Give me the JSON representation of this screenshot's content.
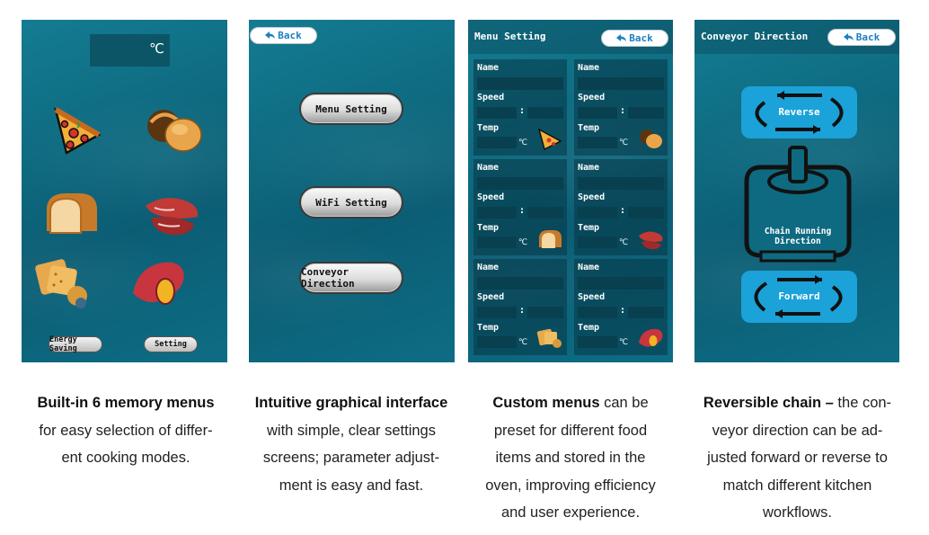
{
  "screen1": {
    "temp_unit": "℃",
    "foods": [
      {
        "icon": "pizza-icon"
      },
      {
        "icon": "bun-icon"
      },
      {
        "icon": "bread-icon"
      },
      {
        "icon": "steak-icon"
      },
      {
        "icon": "cracker-icon"
      },
      {
        "icon": "sweet-potato-icon"
      }
    ],
    "energy_saving_label": "Energy Saving",
    "setting_label": "Setting"
  },
  "screen2": {
    "back_label": "Back",
    "menu_setting_label": "Menu Setting",
    "wifi_setting_label": "WiFi Setting",
    "conveyor_direction_label": "Conveyor Direction"
  },
  "screen3": {
    "title": "Menu Setting",
    "back_label": "Back",
    "name_label": "Name",
    "speed_label": "Speed",
    "temp_label": "Temp",
    "colon": ":",
    "deg": "℃",
    "cards": [
      {
        "icon": "pizza-icon"
      },
      {
        "icon": "bun-icon"
      },
      {
        "icon": "bread-icon"
      },
      {
        "icon": "steak-icon"
      },
      {
        "icon": "cracker-icon"
      },
      {
        "icon": "sweet-potato-icon"
      }
    ]
  },
  "screen4": {
    "title": "Conveyor Direction",
    "back_label": "Back",
    "reverse_label": "Reverse",
    "chain_label": "Chain Running Direction",
    "forward_label": "Forward"
  },
  "captions": [
    {
      "bold": "Built-in 6 memory menus",
      "lines": [
        "for easy selection of differ-",
        "ent cooking modes."
      ]
    },
    {
      "bold": "Intuitive graphical interface",
      "lines": [
        "with simple, clear settings",
        "screens; parameter adjust-",
        "ment is easy and fast."
      ]
    },
    {
      "bold": "Custom menus",
      "after_bold": " can be",
      "lines": [
        "preset for different food",
        "items and stored in the",
        "oven, improving efficiency",
        "and user experience."
      ]
    },
    {
      "bold": "Reversible chain –",
      "after_bold": " the con-",
      "lines": [
        "veyor direction can be ad-",
        "justed forward or reverse to",
        "match different kitchen",
        "workflows."
      ]
    }
  ],
  "colors": {
    "screen_bg": "#0e6a80",
    "button_blue": "#1ba2d8",
    "back_text": "#1b7fc4"
  }
}
